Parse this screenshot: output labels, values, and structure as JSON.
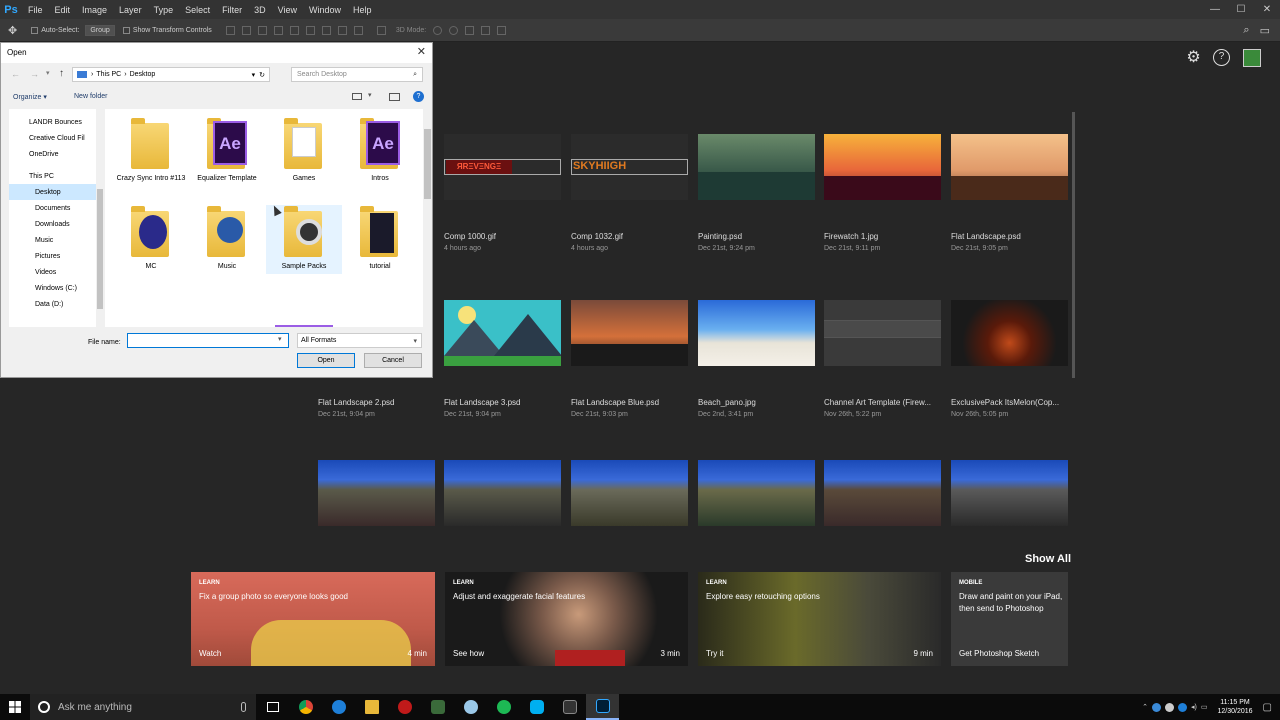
{
  "app": {
    "logo": "Ps"
  },
  "menu": [
    "File",
    "Edit",
    "Image",
    "Layer",
    "Type",
    "Select",
    "Filter",
    "3D",
    "View",
    "Window",
    "Help"
  ],
  "window_controls": {
    "minimize": "—",
    "maximize": "☐",
    "close": "✕"
  },
  "options_bar": {
    "auto_select_label": "Auto-Select:",
    "auto_select_value": "Group",
    "transform_label": "Show Transform Controls",
    "mode_label": "3D Mode:"
  },
  "recent_files": [
    {
      "name": "Comp 1000.gif",
      "time": "4 hours ago"
    },
    {
      "name": "Comp 1032.gif",
      "time": "4 hours ago"
    },
    {
      "name": "Painting.psd",
      "time": "Dec 21st, 9:24 pm"
    },
    {
      "name": "Firewatch 1.jpg",
      "time": "Dec 21st, 9:11 pm"
    },
    {
      "name": "Flat Landscape.psd",
      "time": "Dec 21st, 9:05 pm"
    },
    {
      "name": "Flat Landscape 2.psd",
      "time": "Dec 21st, 9:04 pm"
    },
    {
      "name": "Flat Landscape 3.psd",
      "time": "Dec 21st, 9:04 pm"
    },
    {
      "name": "Flat Landscape Blue.psd",
      "time": "Dec 21st, 9:03 pm"
    },
    {
      "name": "Beach_pano.jpg",
      "time": "Dec 2nd, 3:41 pm"
    },
    {
      "name": "Channel Art Template (Firew...",
      "time": "Nov 26th, 5:22 pm"
    },
    {
      "name": "ExclusivePack ItsMelon(Cop...",
      "time": "Nov 26th, 5:05 pm"
    }
  ],
  "thumb_text": {
    "comp1000": "ЯRΞVΞNGΞ",
    "comp1032": "SKYHIIGH"
  },
  "show_all": "Show All",
  "learn_cards": [
    {
      "category": "LEARN",
      "title": "Fix a group photo so everyone looks good",
      "action": "Watch",
      "duration": "4 min"
    },
    {
      "category": "LEARN",
      "title": "Adjust and exaggerate facial features",
      "action": "See how",
      "duration": "3 min"
    },
    {
      "category": "LEARN",
      "title": "Explore easy retouching options",
      "action": "Try it",
      "duration": "9 min"
    },
    {
      "category": "MOBILE",
      "title": "Draw and paint on your iPad, then send to Photoshop",
      "action": "Get Photoshop Sketch",
      "duration": ""
    }
  ],
  "dialog": {
    "title": "Open",
    "close": "✕",
    "address": {
      "this_pc": "This PC",
      "sep": "›",
      "desktop": "Desktop"
    },
    "search_placeholder": "Search Desktop",
    "organize": "Organize ▾",
    "new_folder": "New folder",
    "nav": [
      {
        "label": "LANDR Bounces",
        "color": "#555"
      },
      {
        "label": "Creative Cloud Fil",
        "color": "#e8b83a"
      },
      {
        "label": "OneDrive",
        "color": "#1e7fd8"
      },
      {
        "label": "This PC",
        "color": "#3a7bd5"
      },
      {
        "label": "Desktop",
        "color": "#3a7bd5"
      },
      {
        "label": "Documents",
        "color": "#6a8fb5"
      },
      {
        "label": "Downloads",
        "color": "#2a6fc9"
      },
      {
        "label": "Music",
        "color": "#4a7fc9"
      },
      {
        "label": "Pictures",
        "color": "#5a8fc9"
      },
      {
        "label": "Videos",
        "color": "#4a6fa9"
      },
      {
        "label": "Windows (C:)",
        "color": "#777"
      },
      {
        "label": "Data (D:)",
        "color": "#999"
      }
    ],
    "files": [
      {
        "label": "Crazy Sync Intro #113",
        "type": "folder"
      },
      {
        "label": "Equalizer Template",
        "type": "ae"
      },
      {
        "label": "Games",
        "type": "folder"
      },
      {
        "label": "Intros",
        "type": "ae"
      },
      {
        "label": "MC",
        "type": "folder"
      },
      {
        "label": "Music",
        "type": "folder"
      },
      {
        "label": "Sample Packs",
        "type": "folder"
      },
      {
        "label": "tutorial",
        "type": "folder"
      }
    ],
    "ae_glyph": "Ae",
    "file_name_label": "File name:",
    "file_name_value": "",
    "format": "All Formats",
    "open_label": "Open",
    "cancel_label": "Cancel"
  },
  "taskbar": {
    "search_placeholder": "Ask me anything",
    "time": "11:15 PM",
    "date": "12/30/2016"
  }
}
